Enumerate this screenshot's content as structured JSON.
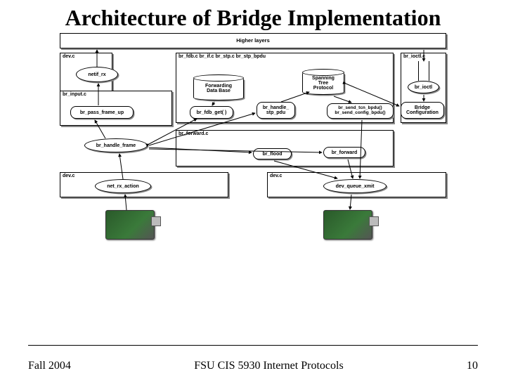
{
  "slide": {
    "title": "Architecture of Bridge Implementation",
    "footer_left": "Fall 2004",
    "footer_center": "FSU CIS 5930 Internet Protocols",
    "footer_right": "10"
  },
  "layers": {
    "higher": "Higher layers",
    "dev_top": "dev.c",
    "mid_files": "br_fdb.c  br_if.c  br_stp.c  br_stp_bpdu",
    "ioctl": "br_ioctl.c",
    "input": "br_input.c",
    "forward": "br_forward.c",
    "dev_bl": "dev.c",
    "dev_br": "dev.c"
  },
  "nodes": {
    "netif_rx": "netif_rx",
    "fdb": "Forwarding\nData Base",
    "stp": "Spanning\nTree\nProtocol",
    "ioctl": "br_ioctl",
    "bridgecfg": "Bridge\nConfiguration",
    "pass_up": "br_pass_frame_up",
    "fdb_get": "br_fdb_get( )",
    "handle_stp": "br_handle_\nstp_pdu",
    "send_bpdu": "br_send_tcn_bpdu()\nbr_send_config_bpdu()",
    "handle_frame": "br_handle_frame",
    "flood": "br_flood",
    "br_forward": "br_forward",
    "net_rx_action": "net_rx_action",
    "dev_queue_xmit": "dev_queue_xmit"
  }
}
